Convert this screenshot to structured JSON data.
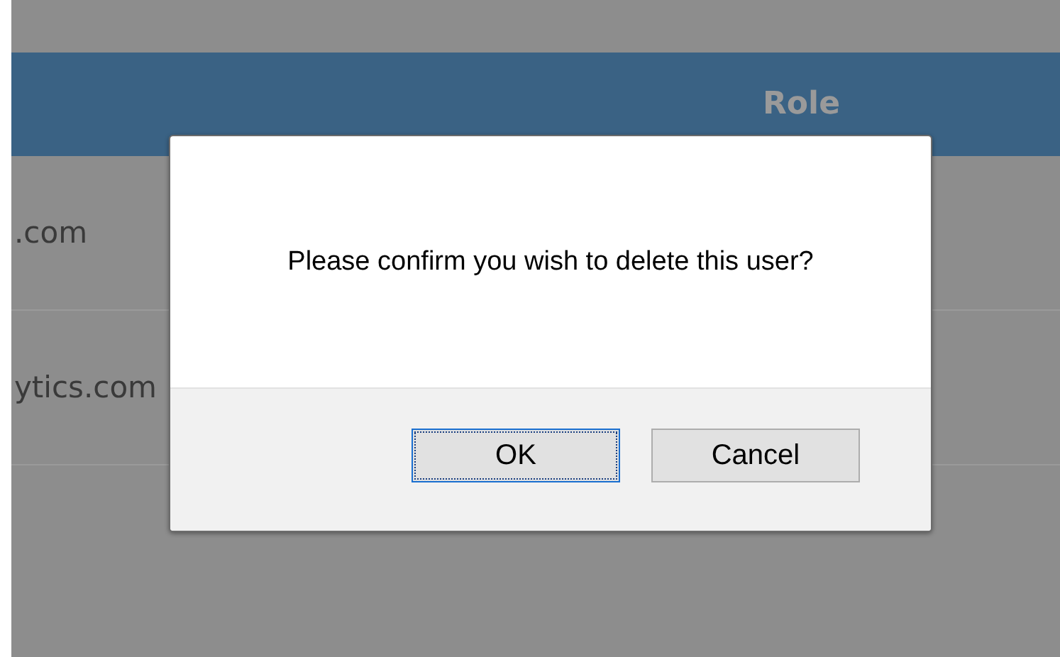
{
  "table": {
    "columns": [
      "Role"
    ],
    "rows": [
      {
        "cells": [
          ".com"
        ]
      },
      {
        "cells": [
          "ytics.com"
        ]
      }
    ]
  },
  "dialog": {
    "message": "Please confirm you wish to delete this user?",
    "buttons": [
      {
        "label": "OK",
        "focused": true
      },
      {
        "label": "Cancel",
        "focused": false
      }
    ]
  }
}
